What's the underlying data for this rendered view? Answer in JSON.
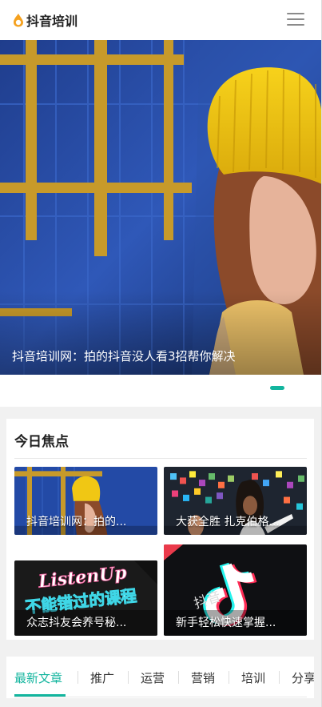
{
  "header": {
    "logo_text": "抖音培训",
    "logo_icon": "flame-icon",
    "menu_icon": "hamburger-menu-icon"
  },
  "banner": {
    "caption": "抖音培训网：拍的抖音没人看3招帮你解决",
    "slides_total": 2,
    "active_slide": 1
  },
  "focus": {
    "title": "今日焦点",
    "cards": [
      {
        "title": "抖音培训网：拍的..."
      },
      {
        "title": "大获全胜 扎克伯格..."
      },
      {
        "title": "众志抖友会养号秘...",
        "image_text": [
          "ListenUp",
          "不能错过的课程"
        ]
      },
      {
        "title": "新手轻松快速掌握...",
        "image_text": "抖音"
      }
    ]
  },
  "tabs": {
    "items": [
      "最新文章",
      "推广",
      "运营",
      "营销",
      "培训",
      "分享"
    ],
    "active_index": 0
  },
  "colors": {
    "accent": "#13b59e",
    "logo_orange": "#f5a11e"
  }
}
